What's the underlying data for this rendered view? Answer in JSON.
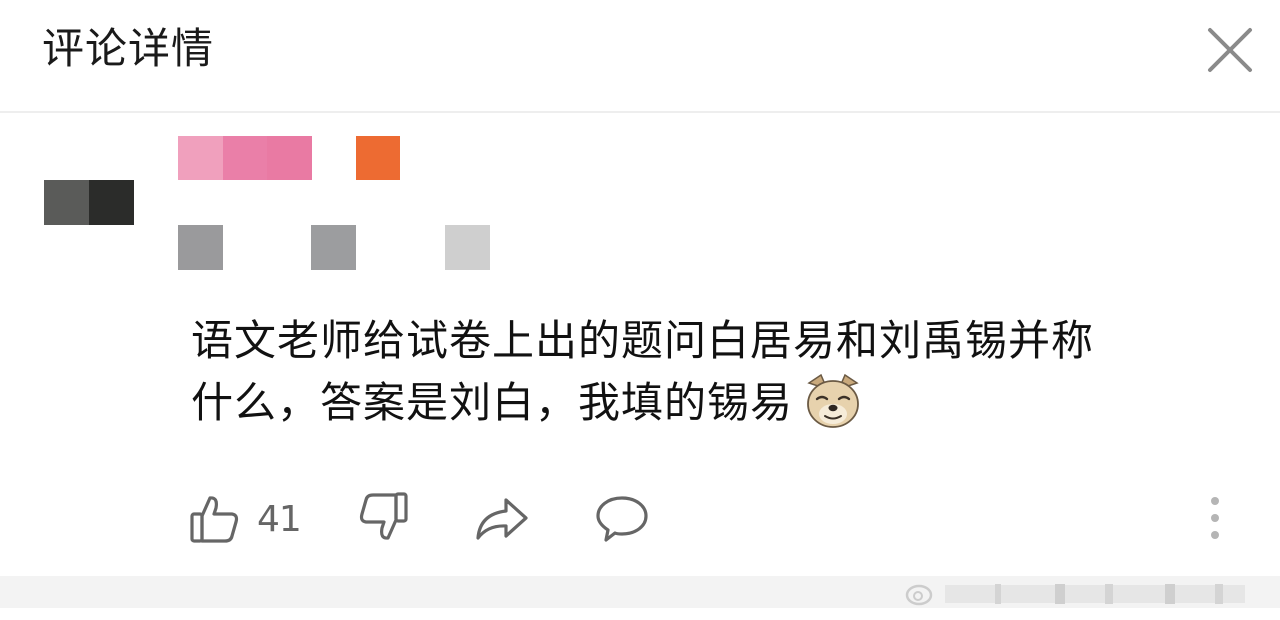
{
  "header": {
    "title": "评论详情",
    "close_icon": "close-icon"
  },
  "comment": {
    "avatar_colors": [
      "#5a5b59",
      "#2b2c2a"
    ],
    "name_colors": [
      "#f0a0bd",
      "#ea7fa8",
      "#e97aa3"
    ],
    "badge_color": "#ed6b32",
    "meta_colors": [
      "#9a9a9c",
      "#9c9d9f",
      "#cfcfcf"
    ],
    "text_line1": "语文老师给试卷上出的题问白居易和刘禹锡并称",
    "text_line2": "什么，答案是刘白，我填的锡易",
    "emoji_icon": "doge-dog-emoji-icon"
  },
  "actions": {
    "like_icon": "thumbs-up-icon",
    "like_count": "41",
    "dislike_icon": "thumbs-down-icon",
    "share_icon": "share-arrow-icon",
    "comment_icon": "comment-bubble-icon",
    "more_icon": "more-vertical-icon"
  },
  "colors": {
    "icon_gray": "#666666",
    "divider": "#eeeeee",
    "bottom_bar": "#f3f3f3"
  }
}
